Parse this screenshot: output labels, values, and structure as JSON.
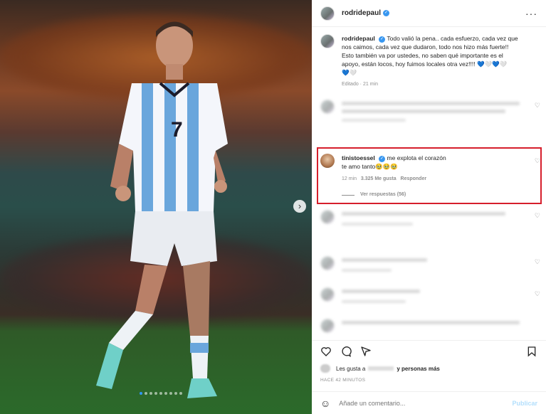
{
  "post": {
    "username": "rodridepaul",
    "caption_lines": [
      "Todo valió la pena.. cada esfuerzo, cada vez que",
      "nos caimos, cada vez que dudaron, todo nos hizo más fuerte!!",
      "Esto también va por ustedes, no saben qué importante es el",
      "apoyo, están locos, hoy fuimos locales otra vez!!!!"
    ],
    "caption_hearts_1": "💙🤍💙🤍",
    "caption_hearts_2": "💙🤍",
    "caption_meta": "Editado · 21 min"
  },
  "highlight_comment": {
    "username": "tinistoessel",
    "text_line1": "me explota el corazón",
    "text_line2": "te amo tanto🥹🥹🥹",
    "time": "12 min",
    "likes": "3.325 Me gusta",
    "reply": "Responder",
    "view_replies": "Ver respuestas (56)"
  },
  "likes_line": {
    "prefix": "Les gusta a",
    "suffix": "y personas más"
  },
  "timestamp": "HACE 42 MINUTOS",
  "comment_input": {
    "placeholder": "Añade un comentario...",
    "publish": "Publicar"
  },
  "colors": {
    "highlight_border": "#d61f2c",
    "verified": "#3897f0",
    "publish_disabled": "#b2dffc"
  }
}
